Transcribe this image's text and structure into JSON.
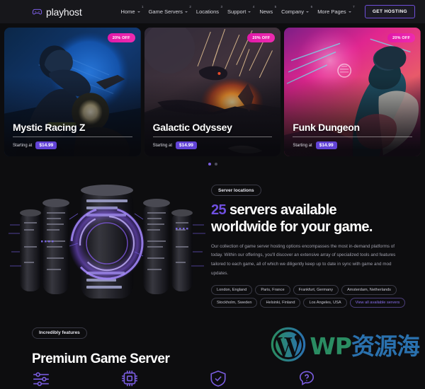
{
  "header": {
    "logo_text": "playhost",
    "logo_icon": "gamepad-icon",
    "nav": [
      {
        "label": "Home",
        "sup": "1"
      },
      {
        "label": "Game Servers",
        "sup": "2"
      },
      {
        "label": "Locations",
        "sup": "3"
      },
      {
        "label": "Support",
        "sup": "4"
      },
      {
        "label": "News",
        "sup": "5"
      },
      {
        "label": "Company",
        "sup": "6"
      },
      {
        "label": "More Pages",
        "sup": "7"
      }
    ],
    "cta_label": "GET HOSTING"
  },
  "hero": {
    "cards": [
      {
        "title": "Mystic Racing Z",
        "badge": "20% OFF",
        "starting_label": "Starting at",
        "price": "$14.99",
        "art": "motorcycle-rider-neon-blue"
      },
      {
        "title": "Galactic Odyssey",
        "badge": "20% OFF",
        "starting_label": "Starting at",
        "price": "$14.99",
        "art": "spaceship-battle-orange-explosion"
      },
      {
        "title": "Funk Dungeon",
        "badge": "20% OFF",
        "starting_label": "Starting at",
        "price": "$14.99",
        "art": "seated-figure-pink-neon"
      }
    ],
    "dots": [
      {
        "active": true
      },
      {
        "active": false
      }
    ]
  },
  "servers": {
    "tag": "Server locations",
    "title_number": "25",
    "title_rest": " servers available",
    "title_line2": "worldwide for your game.",
    "paragraph": "Our collection of game server hosting options encompasses the most in-demand platforms of today. Within our offerings, you'll discover an extensive array of specialized tools and features tailored to each game, all of which we diligently keep up to date in sync with game and mod updates.",
    "locations": [
      "London, England",
      "Paris, France",
      "Frankfurt, Germany",
      "Amsterdam, Netherlands",
      "Stockholm, Sweden",
      "Helsinki, Finland",
      "Los Angeles, USA"
    ],
    "view_all_label": "View all available servers",
    "illustration": "server-racks-glowing-ring"
  },
  "features": {
    "tag": "Incredibly features",
    "title": "Premium Game Server",
    "icons": [
      "sliders-settings-icon",
      "cpu-chip-icon",
      "shield-check-icon",
      "question-chat-bubble-icon"
    ]
  },
  "watermark": {
    "logo": "wordpress-icon",
    "text_latin": "WP",
    "text_cjk": "资源海"
  },
  "colors": {
    "accent_purple": "#6f4fe0",
    "badge_pink": "#e018a8",
    "page_bg": "#0d0d0f",
    "header_bg": "#17171b",
    "price_purple": "#6243d6"
  }
}
